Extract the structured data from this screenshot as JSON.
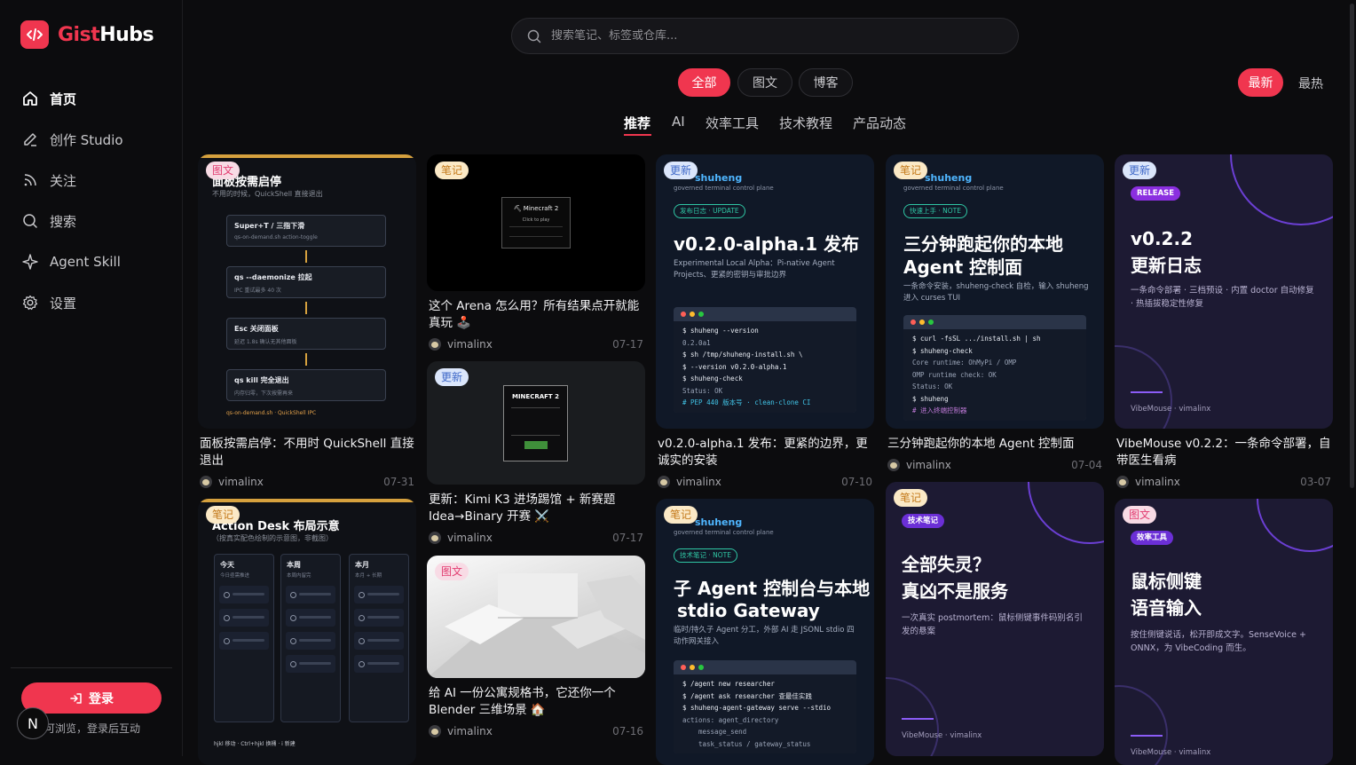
{
  "app": {
    "logo_a": "Gist",
    "logo_b": "Hubs",
    "brand_color": "#f0364f"
  },
  "sidebar": {
    "items": [
      {
        "label": "首页",
        "icon": "home-icon",
        "active": true
      },
      {
        "label": "创作 Studio",
        "icon": "pen-icon"
      },
      {
        "label": "关注",
        "icon": "rss-icon"
      },
      {
        "label": "搜索",
        "icon": "search-icon"
      },
      {
        "label": "Agent Skill",
        "icon": "sparkle-icon"
      },
      {
        "label": "设置",
        "icon": "gear-icon"
      }
    ],
    "login_label": "登录",
    "login_hint": "可浏览，登录后互动",
    "avatar_letter": "N"
  },
  "search": {
    "placeholder": "搜索笔记、标签或仓库..."
  },
  "filters": {
    "all": "全部",
    "image_text": "图文",
    "blog": "博客",
    "latest": "最新",
    "hot": "最热"
  },
  "categories": [
    "推荐",
    "AI",
    "效率工具",
    "技术教程",
    "产品动态"
  ],
  "cards": {
    "c1": {
      "badge": "图文",
      "title": "面板按需启停：不用时 QuickShell 直接退出",
      "author": "vimalinx",
      "date": "07-31",
      "thumb": {
        "title": "面板按需启停",
        "sub": "不用的时候，QuickShell 直接退出",
        "steps": [
          {
            "t": "Super+T / 三指下滑",
            "d": "qs-on-demand.sh action-toggle"
          },
          {
            "t": "qs --daemonize 拉起",
            "d": "IPC 重试最多 40 次"
          },
          {
            "t": "Esc 关闭面板",
            "d": "延迟 1.8s 确认无其他面板"
          },
          {
            "t": "qs kill 完全退出",
            "d": "内存归零，下次按需再来"
          }
        ],
        "foot": "qs-on-demand.sh · QuickShell IPC"
      }
    },
    "c2": {
      "badge": "笔记",
      "title": "Action Desk 布局示意",
      "thumb": {
        "sub": "（按真实配色绘制的示意图，非截图）",
        "cols": [
          {
            "t": "今天",
            "d": "今日亟需推进"
          },
          {
            "t": "本周",
            "d": "本周内留完"
          },
          {
            "t": "本月",
            "d": "本月 + 长期"
          }
        ],
        "foot": "hjkl 移动 · Ctrl+hjkl 换桶 · i 新建"
      }
    },
    "c3": {
      "title": "这个 Arena 怎么用？所有结果点开就能真玩 🕹️",
      "author": "vimalinx",
      "date": "07-17",
      "thumb": {
        "game": "⛏ Minecraft 2",
        "sub": "Click to play"
      }
    },
    "c4": {
      "badge": "更新",
      "title": "更新：Kimi K3 进场踢馆 + 新赛题 Idea→Binary 开赛 ⚔️",
      "author": "vimalinx",
      "date": "07-17",
      "thumb": {
        "game": "MINECRAFT 2"
      }
    },
    "c5": {
      "badge": "图文",
      "title": "给 AI 一份公寓规格书，它还你一个 Blender 三维场景 🏠",
      "author": "vimalinx",
      "date": "07-16"
    },
    "c6": {
      "badge": "更新",
      "title": "v0.2.0-alpha.1 发布：更紧的边界，更诚实的安装",
      "author": "vimalinx",
      "date": "07-10",
      "thumb": {
        "brand": "shuheng",
        "brand_sub": "governed terminal control plane",
        "tag": "发布日志 · UPDATE",
        "big": "v0.2.0-alpha.1 发布",
        "small": "Experimental Local Alpha：Pi-native Agent Projects、更紧的密钥与审批边界",
        "lines": [
          "$ shuheng --version",
          "0.2.0a1",
          "$ sh /tmp/shuheng-install.sh \\",
          "$   --version v0.2.0-alpha.1",
          "$ shuheng-check",
          "Status: OK",
          "# PEP 440 版本号 · clean-clone CI"
        ]
      }
    },
    "c7": {
      "badge": "笔记",
      "title": "子 Agent 控制台与本地 stdio Gateway",
      "thumb": {
        "brand": "shuheng",
        "brand_sub": "governed terminal control plane",
        "tag": "技术笔记 · NOTE",
        "big1": "子 Agent 控制台与本地",
        "big2": "stdio Gateway",
        "small": "临时/持久子 Agent 分工，外部 AI 走 JSONL stdio 四动作网关接入",
        "lines": [
          "$ /agent new researcher",
          "$ /agent ask researcher 查最佳实践",
          "$ shuheng-agent-gateway serve --stdio",
          "actions: agent_directory",
          "message_send",
          "task_status / gateway_status"
        ]
      }
    },
    "c8": {
      "badge": "笔记",
      "title": "三分钟跑起你的本地 Agent 控制面",
      "author": "vimalinx",
      "date": "07-04",
      "thumb": {
        "brand": "shuheng",
        "brand_sub": "governed terminal control plane",
        "tag": "快速上手 · NOTE",
        "big1": "三分钟跑起你的本地",
        "big2": "Agent 控制面",
        "small": "一条命令安装，shuheng-check 自检，输入 shuheng 进入 curses TUI",
        "lines": [
          "$ curl -fsSL .../install.sh | sh",
          "$ shuheng-check",
          "Core runtime: OhMyPi / OMP",
          "OMP runtime check: OK",
          "Status: OK",
          "$ shuheng",
          "# 进入终端控制器"
        ]
      }
    },
    "c9": {
      "badge": "笔记",
      "title": "",
      "thumb": {
        "tag": "技术笔记",
        "big1": "全部失灵？",
        "big2": "真凶不是服务",
        "small": "一次真实 postmortem：鼠标侧键事件码别名引发的悬案",
        "foot1": "VibeMouse",
        "foot2": "vimalinx"
      }
    },
    "c10": {
      "badge": "更新",
      "title": "VibeMouse v0.2.2：一条命令部署，自带医生看病",
      "author": "vimalinx",
      "date": "03-07",
      "thumb": {
        "tag": "RELEASE",
        "big1": "v0.2.2",
        "big2": "更新日志",
        "small": "一条命令部署 · 三档预设 · 内置 doctor 自动修复 · 热插拔稳定性修复",
        "foot1": "VibeMouse",
        "foot2": "vimalinx"
      }
    },
    "c11": {
      "badge": "图文",
      "title": "",
      "thumb": {
        "tag": "效率工具",
        "big1": "鼠标侧键",
        "big2": "语音输入",
        "small": "按住侧键说话，松开即成文字。SenseVoice + ONNX，为 VibeCoding 而生。",
        "foot1": "VibeMouse",
        "foot2": "vimalinx"
      }
    }
  }
}
